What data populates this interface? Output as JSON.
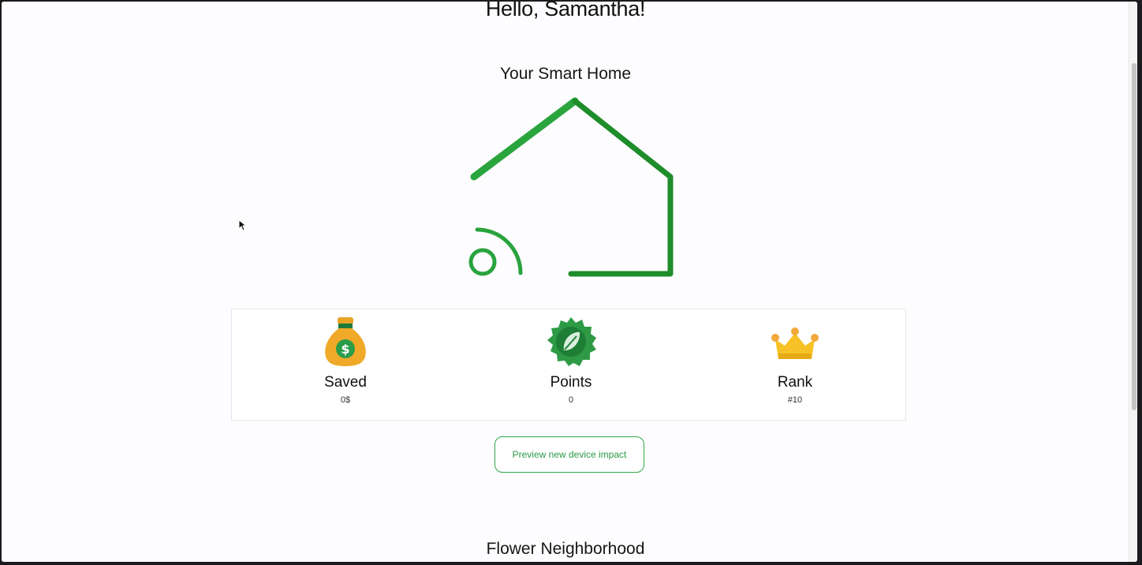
{
  "greeting": "Hello, Samantha!",
  "home": {
    "title": "Your Smart Home",
    "icon": "smart-home-icon",
    "accent": "#2a9a3a"
  },
  "stats": [
    {
      "icon": "money-bag-icon",
      "label": "Saved",
      "value": "0$"
    },
    {
      "icon": "leaf-badge-icon",
      "label": "Points",
      "value": "0"
    },
    {
      "icon": "crown-icon",
      "label": "Rank",
      "value": "#10"
    }
  ],
  "actions": {
    "preview_label": "Preview new device impact"
  },
  "neighborhood": {
    "title": "Flower Neighborhood"
  }
}
